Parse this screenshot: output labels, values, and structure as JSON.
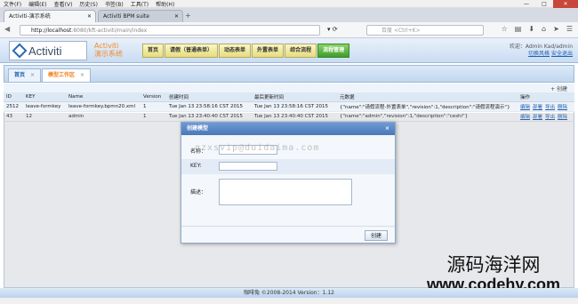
{
  "browser": {
    "menu": [
      "文件(F)",
      "编辑(E)",
      "查看(V)",
      "历史(S)",
      "书签(B)",
      "工具(T)",
      "帮助(H)"
    ],
    "tabs": [
      {
        "label": "Activiti-演示系统",
        "active": true
      },
      {
        "label": "Activiti BPM suite",
        "active": false
      }
    ],
    "url_host": "http://localhost",
    "url_path": ":8080/kft-activiti/main/index",
    "search_placeholder": "百度 <Ctrl+K>"
  },
  "app": {
    "logo_text": "Activiti",
    "title_line1": "Activiti",
    "title_line2": "演示系统",
    "nav": [
      {
        "label": "首页",
        "active": false
      },
      {
        "label": "请假（普通表单）",
        "active": false
      },
      {
        "label": "动态表单",
        "active": false
      },
      {
        "label": "外置表单",
        "active": false
      },
      {
        "label": "综合流程",
        "active": false
      },
      {
        "label": "流程管理",
        "active": true
      }
    ],
    "welcome": "欢迎：Admin Kad/admin",
    "links": [
      "切换风格",
      "安全退出"
    ]
  },
  "content_tabs": [
    {
      "label": "首页",
      "close": "×"
    },
    {
      "label": "模型工作区",
      "close": "×"
    }
  ],
  "toolbar": {
    "new_label": "+ 创建"
  },
  "table": {
    "headers": [
      "ID",
      "KEY",
      "Name",
      "Version",
      "创建时间",
      "最后更新时间",
      "元数据",
      "操作"
    ],
    "rows": [
      {
        "id": "2512",
        "key": "leave-formkey",
        "name": "leave-formkey.bpmn20.xml",
        "version": "1",
        "created": "Tue Jan 13 23:58:16 CST 2015",
        "updated": "Tue Jan 13 23:58:16 CST 2015",
        "meta": "{\"name\":\"请假流程-外置表单\",\"revision\":1,\"description\":\"请假流程演示\"}",
        "ops": [
          "编辑",
          "部署",
          "导出",
          "删除"
        ]
      },
      {
        "id": "43",
        "key": "12",
        "name": "admin",
        "version": "1",
        "created": "Tue Jan 13 23:40:40 CST 2015",
        "updated": "Tue Jan 13 23:40:40 CST 2015",
        "meta": "{\"name\":\"admin\",\"revision\":1,\"description\":\"ceshi\"}",
        "ops": [
          "编辑",
          "部署",
          "导出",
          "删除"
        ]
      }
    ]
  },
  "dialog": {
    "title": "创建模型",
    "close": "×",
    "name_label": "名称：",
    "key_label": "KEY:",
    "desc_label": "描述：",
    "submit": "创建"
  },
  "watermark": "gzxsvip@duidaima.com",
  "footer": "咖啡兔 ©2008-2014 Version：1.12",
  "brand": {
    "cn": "源码海洋网",
    "url": "www.codehy.com"
  }
}
